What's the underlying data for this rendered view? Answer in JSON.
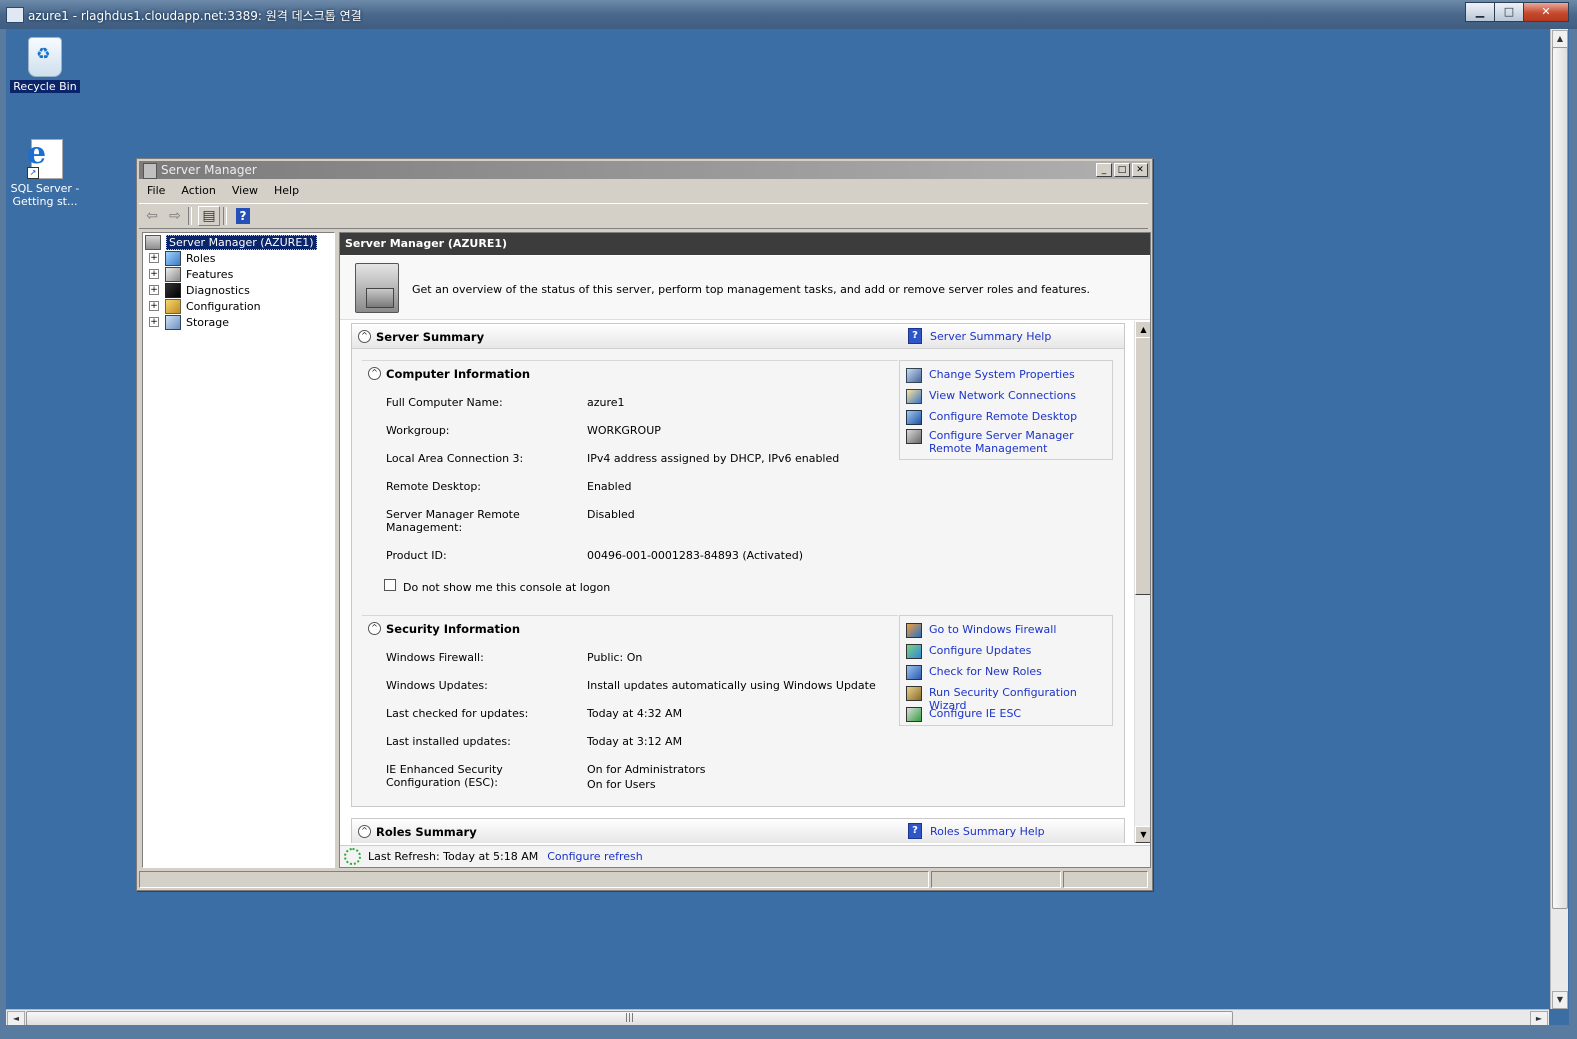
{
  "rdp": {
    "title": "azure1 - rlaghdus1.cloudapp.net:3389: 원격 데스크톱 연결",
    "minimize": "▁",
    "maximize": "□",
    "close": "✕"
  },
  "desktop": {
    "icons": [
      {
        "label": "Recycle Bin",
        "icon": "recycle-bin-icon"
      },
      {
        "label": "SQL Server - Getting st...",
        "icon": "internet-explorer-icon"
      }
    ]
  },
  "window": {
    "title": "Server Manager",
    "controls": {
      "minimize": "_",
      "maximize": "□",
      "close": "✕"
    },
    "menu": [
      "File",
      "Action",
      "View",
      "Help"
    ],
    "toolbar": {
      "back": "⇦",
      "forward": "⇨",
      "console": "▤",
      "help": "?"
    }
  },
  "tree": {
    "root": "Server Manager (AZURE1)",
    "expander": "+",
    "items": [
      "Roles",
      "Features",
      "Diagnostics",
      "Configuration",
      "Storage"
    ]
  },
  "detail": {
    "header": "Server Manager (AZURE1)",
    "intro": "Get an overview of the status of this server, perform top management tasks, and add or remove server roles and features.",
    "chevron": "^",
    "server_summary": {
      "title": "Server Summary",
      "help": "Server Summary Help",
      "computer_info": {
        "title": "Computer Information",
        "rows": [
          {
            "label": "Full Computer Name:",
            "value": "azure1"
          },
          {
            "label": "Workgroup:",
            "value": "WORKGROUP"
          },
          {
            "label": "Local Area Connection 3:",
            "value": "IPv4 address assigned by DHCP, IPv6 enabled"
          },
          {
            "label": "Remote Desktop:",
            "value": "Enabled"
          },
          {
            "label": "Server Manager Remote Management:",
            "value": "Disabled"
          },
          {
            "label": "Product ID:",
            "value": "00496-001-0001283-84893 (Activated)"
          }
        ],
        "checkbox": "Do not show me this console at logon",
        "tasks": [
          "Change System Properties",
          "View Network Connections",
          "Configure Remote Desktop",
          "Configure Server Manager Remote Management"
        ]
      },
      "security_info": {
        "title": "Security Information",
        "rows": [
          {
            "label": "Windows Firewall:",
            "value": "Public: On"
          },
          {
            "label": "Windows Updates:",
            "value": "Install updates automatically using Windows Update"
          },
          {
            "label": "Last checked for updates:",
            "value": "Today at 4:32 AM"
          },
          {
            "label": "Last installed updates:",
            "value": "Today at 3:12 AM"
          },
          {
            "label": "IE Enhanced Security Configuration (ESC):",
            "value": "On for Administrators",
            "value2": "On for Users"
          }
        ],
        "tasks": [
          "Go to Windows Firewall",
          "Configure Updates",
          "Check for New Roles",
          "Run Security Configuration Wizard",
          "Configure IE ESC"
        ]
      }
    },
    "roles_summary": {
      "title": "Roles Summary",
      "help": "Roles Summary Help"
    },
    "refresh": {
      "text": "Last Refresh: Today at 5:18 AM",
      "link": "Configure refresh"
    },
    "scroll": {
      "up": "▲",
      "down": "▼"
    }
  },
  "rdp_scroll": {
    "left": "◄",
    "right": "►",
    "up": "▲",
    "down": "▼",
    "grip": "|||"
  }
}
